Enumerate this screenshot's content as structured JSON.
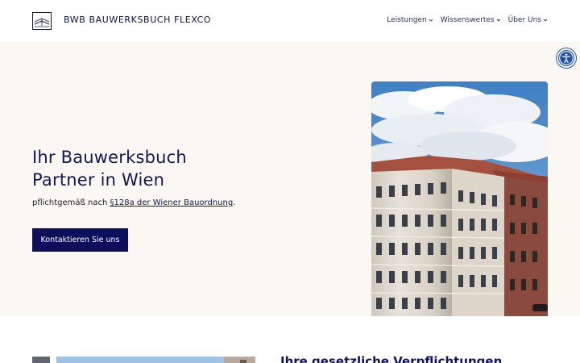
{
  "header": {
    "brand": "BWB BAUWERKSBUCH FLEXCO",
    "nav": [
      {
        "label": "Leistungen"
      },
      {
        "label": "Wissenswertes"
      },
      {
        "label": "Über Uns"
      }
    ]
  },
  "hero": {
    "title_line1": "Ihr Bauwerksbuch",
    "title_line2": "Partner in Wien",
    "subtitle_prefix": "pflichtgemäß nach ",
    "subtitle_link": "§128a der Wiener Bauordnung",
    "subtitle_suffix": ".",
    "cta_label": "Kontaktieren Sie uns"
  },
  "lower": {
    "title": "Ihre gesetzliche Verpflichtungen"
  },
  "colors": {
    "brand_navy": "#0d0f5c",
    "hero_background": "#fbf8f3",
    "accessibility_blue": "#1d4fa5"
  },
  "icons": {
    "logo": "book-logo-icon",
    "chevron": "chevron-down-icon",
    "accessibility": "accessibility-icon"
  }
}
